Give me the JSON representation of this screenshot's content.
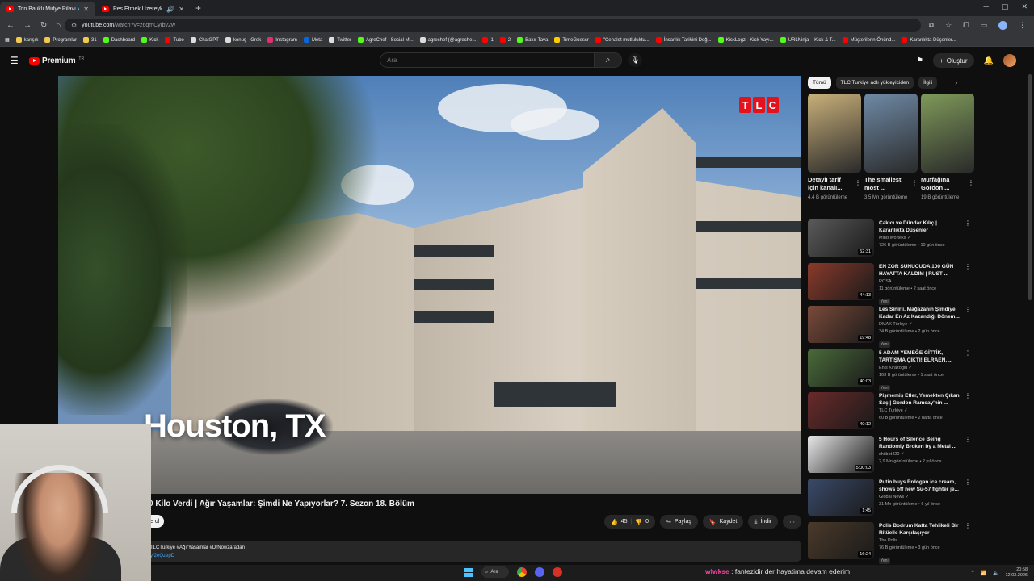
{
  "browser": {
    "tabs": [
      {
        "title": "Ton Balıklı Midye Pilavı 🐟 - Yo",
        "active": true
      },
      {
        "title": "Pes Etmek Üzereyken 110 K",
        "active": false
      }
    ],
    "url_host": "youtube.com",
    "url_path": "/watch?v=z6qmCyIbv2w",
    "bookmarks": [
      {
        "label": "karışık",
        "color": "#f2c94c"
      },
      {
        "label": "Programlar",
        "color": "#f2c94c"
      },
      {
        "label": "31",
        "color": "#f2c94c"
      },
      {
        "label": "Dashboard",
        "color": "#53fc18"
      },
      {
        "label": "Kick",
        "color": "#53fc18"
      },
      {
        "label": "Tube",
        "color": "#ff0000"
      },
      {
        "label": "ChatGPT",
        "color": "#dddddd"
      },
      {
        "label": "konuş - Grok",
        "color": "#dddddd"
      },
      {
        "label": "Instagram",
        "color": "#e1306c"
      },
      {
        "label": "Meta",
        "color": "#0668e1"
      },
      {
        "label": "Twitter",
        "color": "#dddddd"
      },
      {
        "label": "AgreChef - Social M...",
        "color": "#53fc18"
      },
      {
        "label": "agrechef (@agreche...",
        "color": "#dddddd"
      },
      {
        "label": "1",
        "color": "#ff0000"
      },
      {
        "label": "2",
        "color": "#ff0000"
      },
      {
        "label": "Bakır Tava",
        "color": "#53fc18"
      },
      {
        "label": "TimeGuessr",
        "color": "#ffcc00"
      },
      {
        "label": "\"Cehalet mutluluktu...",
        "color": "#ff0000"
      },
      {
        "label": "İnsanlık Tarihini Değ...",
        "color": "#ff0000"
      },
      {
        "label": "KickLogz - Kick Yayı...",
        "color": "#53fc18"
      },
      {
        "label": "URLNinja – Kick & T...",
        "color": "#53fc18"
      },
      {
        "label": "Müşterilerin Önünd...",
        "color": "#ff0000"
      },
      {
        "label": "Karanlıkta Düşenler...",
        "color": "#ff0000"
      }
    ]
  },
  "youtube": {
    "logo_text": "Premium",
    "logo_sup": "TR",
    "search_placeholder": "Ara",
    "create_label": "Oluştur"
  },
  "player": {
    "overlay_text": "Houston, TX",
    "channel_logo": [
      "T",
      "L",
      "C"
    ]
  },
  "video": {
    "title": "0 Kilo Verdi | Ağır Yaşamlar: Şimdi Ne Yapıyorlar? 7. Sezon 18. Bölüm",
    "subscribe_label": "e ol",
    "likes": "45",
    "dislikes": "0",
    "share_label": "Paylaş",
    "save_label": "Kaydet",
    "download_label": "İndir",
    "desc_line1": "TLCTürkiye #AğırYaşamlar #DrNowzaradan",
    "desc_link": "y/2eQzepD"
  },
  "sidebar": {
    "chips": [
      {
        "label": "Tümü",
        "active": true
      },
      {
        "label": "TLC Turkiye adlı yükleyiciden",
        "active": false
      },
      {
        "label": "İlgili",
        "active": false
      }
    ],
    "shorts": [
      {
        "title": "Detaylı tarif için kanalı...",
        "views": "4,4 B görüntüleme",
        "color": "#c9b07a"
      },
      {
        "title": "The smallest most ...",
        "views": "3,5 Mn görüntüleme",
        "color": "#6f8aa6"
      },
      {
        "title": "Mutfağına Gordon ...",
        "views": "19 B görüntüleme",
        "color": "#7f9a5a"
      }
    ],
    "recommended": [
      {
        "title": "Çakıcı ve Dündar Kılıç | Karanlıkta Düşenler",
        "channel": "Mind Worteks ✓",
        "meta": "726 B görüntüleme • 10 gün önce",
        "duration": "52:31",
        "new": false,
        "color": "#5a5a5a"
      },
      {
        "title": "EN ZOR SUNUCUDA 100 GÜN HAYATTA KALDIM | RUST ...",
        "channel": "ROSA",
        "meta": "11 görüntüleme • 2 saat önce",
        "duration": "44:13",
        "new": true,
        "color": "#8a3a2a"
      },
      {
        "title": "Les Sinirli, Mağazanın Şimdiye Kadar En Az Kazandığı Dönem...",
        "channel": "DMAX Türkiye ✓",
        "meta": "34 B görüntüleme • 2 gün önce",
        "duration": "19:48",
        "new": true,
        "color": "#7a4a3a"
      },
      {
        "title": "5 ADAM YEMEĞE GİTTİK, TARTIŞMA ÇIKTI! ELRAEN, ...",
        "channel": "Enis Kirazoglu ✓",
        "meta": "163 B görüntüleme • 1 saat önce",
        "duration": "40:03",
        "new": true,
        "color": "#4a6a3a"
      },
      {
        "title": "Pişmemiş Etler, Yemekten Çıkan Saç | Gordon Ramsay'nin ...",
        "channel": "TLC Turkiye ✓",
        "meta": "60 B görüntüleme • 2 hafta önce",
        "duration": "40:12",
        "new": false,
        "color": "#6a2a2a"
      },
      {
        "title": "5 Hours of Silence Being Randomly Broken by a Metal ...",
        "channel": "shitbot420 ✓",
        "meta": "2,9 Mn görüntüleme • 2 yıl önce",
        "duration": "5:00:03",
        "new": false,
        "color": "#e8e8e8"
      },
      {
        "title": "Putin buys Erdogan ice cream, shows off new Su-57 fighter je...",
        "channel": "Global News ✓",
        "meta": "31 Mn görüntüleme • 6 yıl önce",
        "duration": "1:45",
        "new": false,
        "color": "#3a4a6a"
      },
      {
        "title": "Polis Bodrum Katta Tehlikeli Bir Ritüelle Karşılaşıyor",
        "channel": "The Polis",
        "meta": "76 B görüntüleme • 3 gün önce",
        "duration": "16:24",
        "new": true,
        "color": "#4a3a2a"
      }
    ]
  },
  "taskbar": {
    "search_label": "Ara",
    "chat_username": "wlwkse",
    "chat_message": ": fantezidir der hayatima devam ederim",
    "time": "20:58",
    "date": "12.03.2026"
  }
}
